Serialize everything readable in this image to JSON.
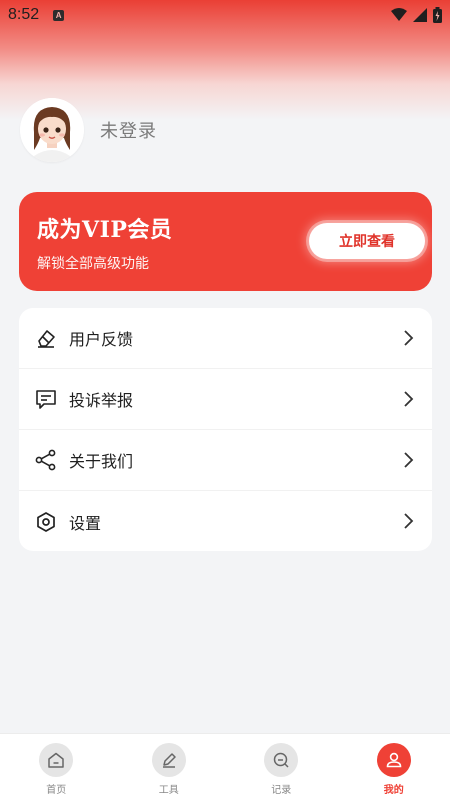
{
  "statusbar": {
    "time": "8:52",
    "notification_letter": "A"
  },
  "profile": {
    "login_status": "未登录"
  },
  "vip": {
    "title": "成为VIP会员",
    "subtitle": "解锁全部高级功能",
    "button": "立即查看",
    "color": "#ef4136"
  },
  "menu": {
    "items": [
      {
        "label": "用户反馈",
        "icon": "eraser-icon"
      },
      {
        "label": "投诉举报",
        "icon": "message-icon"
      },
      {
        "label": "关于我们",
        "icon": "share-icon"
      },
      {
        "label": "设置",
        "icon": "hexagon-settings-icon"
      }
    ]
  },
  "tabbar": {
    "tabs": [
      {
        "label": "首页",
        "icon": "home-icon",
        "active": false
      },
      {
        "label": "工具",
        "icon": "pen-icon",
        "active": false
      },
      {
        "label": "记录",
        "icon": "record-icon",
        "active": false
      },
      {
        "label": "我的",
        "icon": "user-icon",
        "active": true
      }
    ],
    "active_color": "#ef4136"
  }
}
